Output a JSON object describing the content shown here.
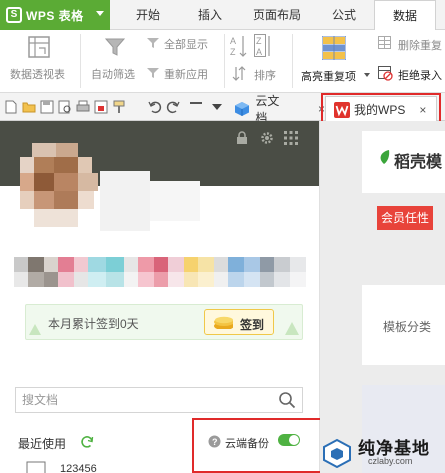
{
  "app": {
    "name": "WPS 表格",
    "logo_letter": "S"
  },
  "menu_tabs": [
    "开始",
    "插入",
    "页面布局",
    "公式",
    "数据"
  ],
  "active_menu_tab": "数据",
  "ribbon": {
    "pivot_table": "数据透视表",
    "auto_filter": "自动筛选",
    "show_all": "全部显示",
    "reapply": "重新应用",
    "sort": "排序",
    "highlight_duplicates": "高亮重复项",
    "remove_duplicates": "删除重复",
    "reject_duplicates": "拒绝录入"
  },
  "doc_tabs": [
    {
      "label": "云文档"
    },
    {
      "label": "我的WPS"
    }
  ],
  "left_panel": {
    "checkin_text": "本月累计签到0天",
    "checkin_button": "签到",
    "search_placeholder": "搜文档",
    "recent_label": "最近使用",
    "cloud_backup_label": "云端备份",
    "cloud_backup_on": true,
    "recent_file_partial": "123456"
  },
  "right_panel": {
    "title": "稻壳模",
    "badge": "会员任性",
    "template_category": "模板分类"
  },
  "watermark": {
    "title": "纯净基地",
    "url": "czlaby.com"
  },
  "colors": {
    "brand_green": "#5bab35",
    "hero_bg": "#4a4d45",
    "highlight_red": "#e02a2a",
    "badge_red": "#e8433a"
  }
}
